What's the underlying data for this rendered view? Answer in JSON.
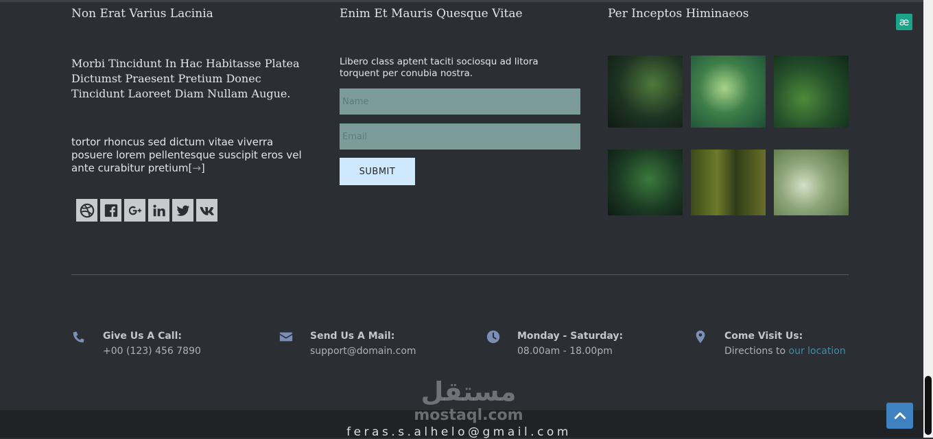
{
  "columns": {
    "col1": {
      "title": "Non Erat Varius Lacinia",
      "serif_paragraph": "Morbi Tincidunt In Hac Habitasse Platea Dictumst Praesent Pretium Donec Tincidunt Laoreet Diam Nullam Augue.",
      "sans_paragraph": "tortor rhoncus sed dictum vitae viverra posuere lorem pellentesque suscipit eros vel ante curabitur pretium",
      "read_more_open": "[",
      "read_more_arrow": "→",
      "read_more_close": "]",
      "social_icons": [
        "dribbble-icon",
        "facebook-icon",
        "google-plus-icon",
        "linkedin-icon",
        "twitter-icon",
        "vk-icon"
      ]
    },
    "col2": {
      "title": "Enim Et Mauris Quesque Vitae",
      "paragraph": "Libero class aptent taciti sociosqu ad litora torquent per conubia nostra.",
      "name_placeholder": "Name",
      "email_placeholder": "Email",
      "submit_label": "SUBMIT"
    },
    "col3": {
      "title": "Per Inceptos Himinaeos",
      "gallery_count": 6
    }
  },
  "contact": [
    {
      "icon": "phone-icon",
      "title": "Give Us A Call:",
      "value": "+00 (123) 456 7890"
    },
    {
      "icon": "envelope-icon",
      "title": "Send Us A Mail:",
      "value": "support@domain.com"
    },
    {
      "icon": "clock-icon",
      "title": "Monday - Saturday:",
      "value": "08.00am - 18.00pm"
    },
    {
      "icon": "map-marker-icon",
      "title": "Come Visit Us:",
      "value_prefix": "Directions to ",
      "link": "our location"
    }
  ],
  "footer": {
    "email": "feras.s.alhelo@gmail.com"
  },
  "watermark": {
    "arabic": "مستقل",
    "latin": "mostaql.com"
  },
  "badge": {
    "text": "æ"
  },
  "colors": {
    "background": "#2b2e33",
    "field": "#7c9c9c",
    "submit": "#cfe8fc",
    "icon_accent": "#7b8eb8",
    "link": "#3e8da6",
    "badge": "#1aa58b",
    "to_top": "#3f82c0"
  }
}
